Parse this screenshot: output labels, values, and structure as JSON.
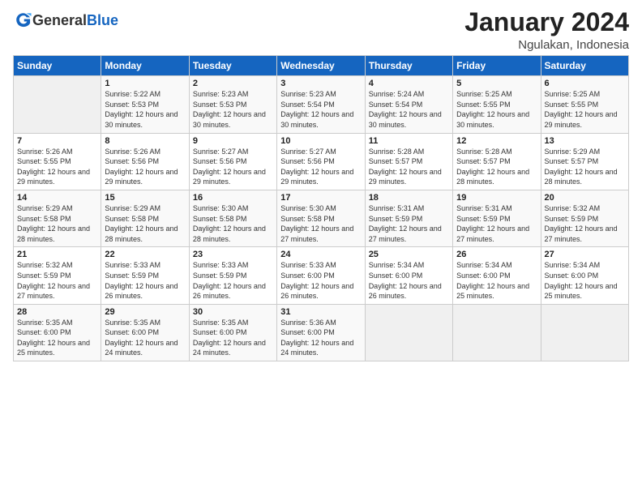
{
  "header": {
    "logo_general": "General",
    "logo_blue": "Blue",
    "title": "January 2024",
    "subtitle": "Ngulakan, Indonesia"
  },
  "days_of_week": [
    "Sunday",
    "Monday",
    "Tuesday",
    "Wednesday",
    "Thursday",
    "Friday",
    "Saturday"
  ],
  "weeks": [
    [
      {
        "day": "",
        "empty": true
      },
      {
        "day": "1",
        "sunrise": "Sunrise: 5:22 AM",
        "sunset": "Sunset: 5:53 PM",
        "daylight": "Daylight: 12 hours and 30 minutes."
      },
      {
        "day": "2",
        "sunrise": "Sunrise: 5:23 AM",
        "sunset": "Sunset: 5:53 PM",
        "daylight": "Daylight: 12 hours and 30 minutes."
      },
      {
        "day": "3",
        "sunrise": "Sunrise: 5:23 AM",
        "sunset": "Sunset: 5:54 PM",
        "daylight": "Daylight: 12 hours and 30 minutes."
      },
      {
        "day": "4",
        "sunrise": "Sunrise: 5:24 AM",
        "sunset": "Sunset: 5:54 PM",
        "daylight": "Daylight: 12 hours and 30 minutes."
      },
      {
        "day": "5",
        "sunrise": "Sunrise: 5:25 AM",
        "sunset": "Sunset: 5:55 PM",
        "daylight": "Daylight: 12 hours and 30 minutes."
      },
      {
        "day": "6",
        "sunrise": "Sunrise: 5:25 AM",
        "sunset": "Sunset: 5:55 PM",
        "daylight": "Daylight: 12 hours and 29 minutes."
      }
    ],
    [
      {
        "day": "7",
        "sunrise": "Sunrise: 5:26 AM",
        "sunset": "Sunset: 5:55 PM",
        "daylight": "Daylight: 12 hours and 29 minutes."
      },
      {
        "day": "8",
        "sunrise": "Sunrise: 5:26 AM",
        "sunset": "Sunset: 5:56 PM",
        "daylight": "Daylight: 12 hours and 29 minutes."
      },
      {
        "day": "9",
        "sunrise": "Sunrise: 5:27 AM",
        "sunset": "Sunset: 5:56 PM",
        "daylight": "Daylight: 12 hours and 29 minutes."
      },
      {
        "day": "10",
        "sunrise": "Sunrise: 5:27 AM",
        "sunset": "Sunset: 5:56 PM",
        "daylight": "Daylight: 12 hours and 29 minutes."
      },
      {
        "day": "11",
        "sunrise": "Sunrise: 5:28 AM",
        "sunset": "Sunset: 5:57 PM",
        "daylight": "Daylight: 12 hours and 29 minutes."
      },
      {
        "day": "12",
        "sunrise": "Sunrise: 5:28 AM",
        "sunset": "Sunset: 5:57 PM",
        "daylight": "Daylight: 12 hours and 28 minutes."
      },
      {
        "day": "13",
        "sunrise": "Sunrise: 5:29 AM",
        "sunset": "Sunset: 5:57 PM",
        "daylight": "Daylight: 12 hours and 28 minutes."
      }
    ],
    [
      {
        "day": "14",
        "sunrise": "Sunrise: 5:29 AM",
        "sunset": "Sunset: 5:58 PM",
        "daylight": "Daylight: 12 hours and 28 minutes."
      },
      {
        "day": "15",
        "sunrise": "Sunrise: 5:29 AM",
        "sunset": "Sunset: 5:58 PM",
        "daylight": "Daylight: 12 hours and 28 minutes."
      },
      {
        "day": "16",
        "sunrise": "Sunrise: 5:30 AM",
        "sunset": "Sunset: 5:58 PM",
        "daylight": "Daylight: 12 hours and 28 minutes."
      },
      {
        "day": "17",
        "sunrise": "Sunrise: 5:30 AM",
        "sunset": "Sunset: 5:58 PM",
        "daylight": "Daylight: 12 hours and 27 minutes."
      },
      {
        "day": "18",
        "sunrise": "Sunrise: 5:31 AM",
        "sunset": "Sunset: 5:59 PM",
        "daylight": "Daylight: 12 hours and 27 minutes."
      },
      {
        "day": "19",
        "sunrise": "Sunrise: 5:31 AM",
        "sunset": "Sunset: 5:59 PM",
        "daylight": "Daylight: 12 hours and 27 minutes."
      },
      {
        "day": "20",
        "sunrise": "Sunrise: 5:32 AM",
        "sunset": "Sunset: 5:59 PM",
        "daylight": "Daylight: 12 hours and 27 minutes."
      }
    ],
    [
      {
        "day": "21",
        "sunrise": "Sunrise: 5:32 AM",
        "sunset": "Sunset: 5:59 PM",
        "daylight": "Daylight: 12 hours and 27 minutes."
      },
      {
        "day": "22",
        "sunrise": "Sunrise: 5:33 AM",
        "sunset": "Sunset: 5:59 PM",
        "daylight": "Daylight: 12 hours and 26 minutes."
      },
      {
        "day": "23",
        "sunrise": "Sunrise: 5:33 AM",
        "sunset": "Sunset: 5:59 PM",
        "daylight": "Daylight: 12 hours and 26 minutes."
      },
      {
        "day": "24",
        "sunrise": "Sunrise: 5:33 AM",
        "sunset": "Sunset: 6:00 PM",
        "daylight": "Daylight: 12 hours and 26 minutes."
      },
      {
        "day": "25",
        "sunrise": "Sunrise: 5:34 AM",
        "sunset": "Sunset: 6:00 PM",
        "daylight": "Daylight: 12 hours and 26 minutes."
      },
      {
        "day": "26",
        "sunrise": "Sunrise: 5:34 AM",
        "sunset": "Sunset: 6:00 PM",
        "daylight": "Daylight: 12 hours and 25 minutes."
      },
      {
        "day": "27",
        "sunrise": "Sunrise: 5:34 AM",
        "sunset": "Sunset: 6:00 PM",
        "daylight": "Daylight: 12 hours and 25 minutes."
      }
    ],
    [
      {
        "day": "28",
        "sunrise": "Sunrise: 5:35 AM",
        "sunset": "Sunset: 6:00 PM",
        "daylight": "Daylight: 12 hours and 25 minutes."
      },
      {
        "day": "29",
        "sunrise": "Sunrise: 5:35 AM",
        "sunset": "Sunset: 6:00 PM",
        "daylight": "Daylight: 12 hours and 24 minutes."
      },
      {
        "day": "30",
        "sunrise": "Sunrise: 5:35 AM",
        "sunset": "Sunset: 6:00 PM",
        "daylight": "Daylight: 12 hours and 24 minutes."
      },
      {
        "day": "31",
        "sunrise": "Sunrise: 5:36 AM",
        "sunset": "Sunset: 6:00 PM",
        "daylight": "Daylight: 12 hours and 24 minutes."
      },
      {
        "day": "",
        "empty": true
      },
      {
        "day": "",
        "empty": true
      },
      {
        "day": "",
        "empty": true
      }
    ]
  ]
}
